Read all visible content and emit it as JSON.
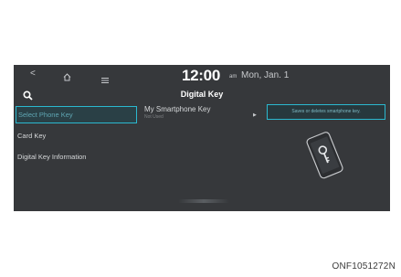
{
  "status_bar": {
    "clock": "12:00",
    "ampm": "am",
    "date": "Mon, Jan. 1"
  },
  "page_title": "Digital Key",
  "sidebar": {
    "items": [
      {
        "label": "Select Phone Key",
        "selected": true
      },
      {
        "label": "Card Key",
        "selected": false
      },
      {
        "label": "Digital Key Information",
        "selected": false
      }
    ]
  },
  "content": {
    "title": "My Smartphone Key",
    "subtitle": "Not Used",
    "tooltip": "Saves or deletes smartphone key."
  },
  "caption": "ONF1051272N",
  "colors": {
    "screen_bg": "#36383b",
    "accent": "#2bb8cf"
  }
}
